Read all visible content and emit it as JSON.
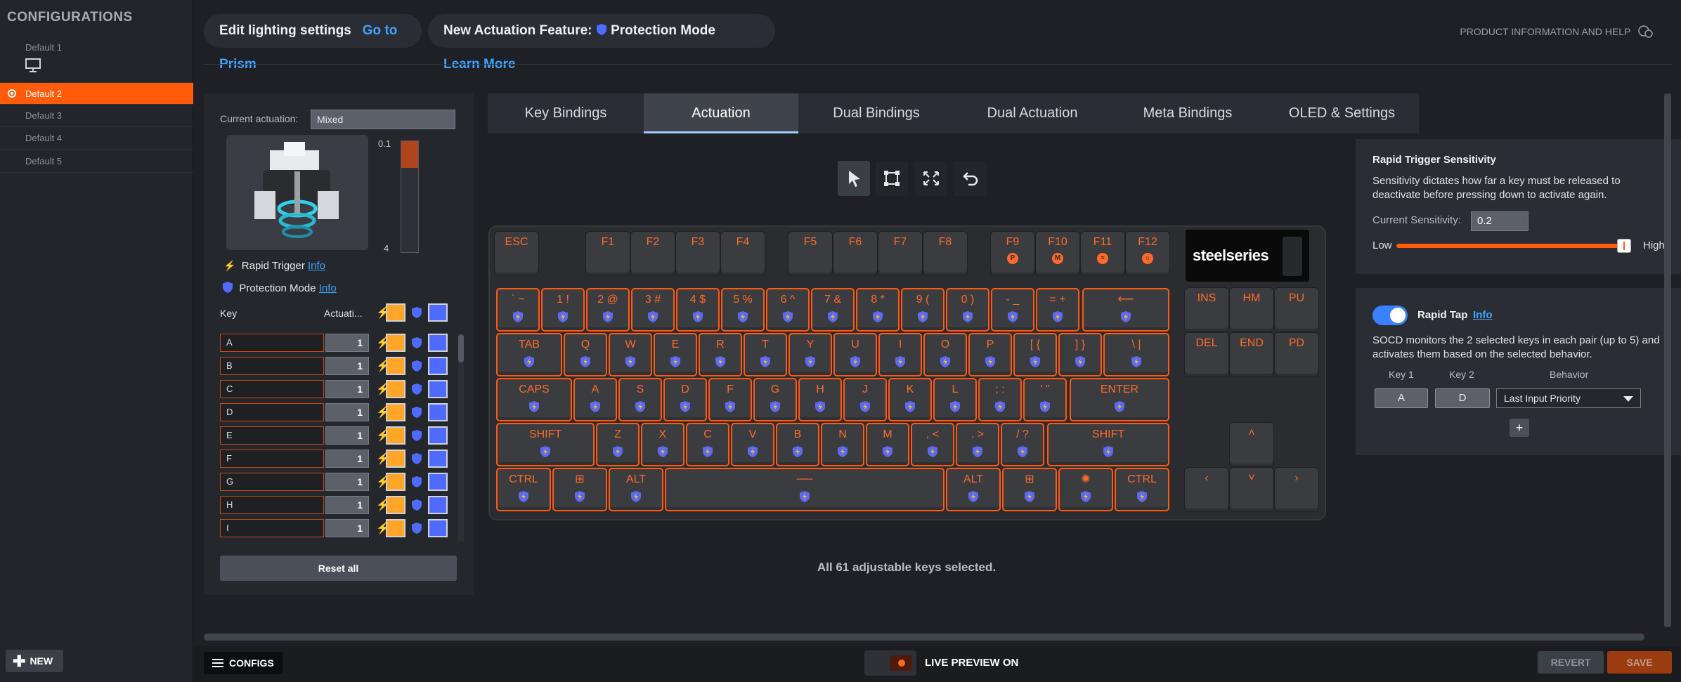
{
  "sidebar": {
    "title": "CONFIGURATIONS",
    "items": [
      {
        "label": "Default 1"
      },
      {
        "label": "Default 2"
      },
      {
        "label": "Default 3"
      },
      {
        "label": "Default 4"
      },
      {
        "label": "Default 5"
      }
    ],
    "active_index": 1,
    "new_label": "NEW"
  },
  "header": {
    "lighting_text": "Edit lighting settings",
    "lighting_link": "Go to Prism",
    "feature_text": "New Actuation Feature:",
    "feature_name": "Protection Mode",
    "feature_link": "Learn More",
    "help": "PRODUCT INFORMATION AND HELP"
  },
  "left_panel": {
    "current_actuation_label": "Current actuation:",
    "current_actuation_value": "Mixed",
    "gauge_top": "0.1",
    "gauge_bottom": "4",
    "rapid_trigger_label": "Rapid Trigger",
    "protection_mode_label": "Protection Mode",
    "info_link": "Info",
    "col_key": "Key",
    "col_actuation": "Actuati...",
    "rows": [
      {
        "key": "A",
        "value": "1"
      },
      {
        "key": "B",
        "value": "1"
      },
      {
        "key": "C",
        "value": "1"
      },
      {
        "key": "D",
        "value": "1"
      },
      {
        "key": "E",
        "value": "1"
      },
      {
        "key": "F",
        "value": "1"
      },
      {
        "key": "G",
        "value": "1"
      },
      {
        "key": "H",
        "value": "1"
      },
      {
        "key": "I",
        "value": "1"
      }
    ],
    "reset_label": "Reset all"
  },
  "tabs": [
    "Key Bindings",
    "Actuation",
    "Dual Bindings",
    "Dual Actuation",
    "Meta Bindings",
    "OLED & Settings"
  ],
  "active_tab": 1,
  "keyboard": {
    "brand": "steelseries",
    "selection_message": "All 61 adjustable keys selected."
  },
  "right_panel": {
    "sensitivity_title": "Rapid Trigger Sensitivity",
    "sensitivity_desc": "Sensitivity dictates how far a key must be released to deactivate before pressing down to activate again.",
    "current_sensitivity_label": "Current Sensitivity:",
    "current_sensitivity_value": "0.2",
    "slider_low": "Low",
    "slider_high": "High",
    "rapid_tap_label": "Rapid Tap",
    "rapid_tap_info": "Info",
    "socd_desc": "SOCD monitors the 2 selected keys in each pair (up to 5) and activates them based on the selected behavior.",
    "col_key1": "Key 1",
    "col_key2": "Key 2",
    "col_behavior": "Behavior",
    "key1": "A",
    "key2": "D",
    "behavior": "Last Input Priority",
    "add_label": "+"
  },
  "bottom": {
    "configs_label": "CONFIGS",
    "live_preview": "LIVE PREVIEW ON",
    "revert": "REVERT",
    "save": "SAVE"
  },
  "colors": {
    "accent": "#ff5b0a",
    "link": "#3fa3ff",
    "protection": "#4f6bff",
    "rapid_trigger": "#ffa528"
  }
}
